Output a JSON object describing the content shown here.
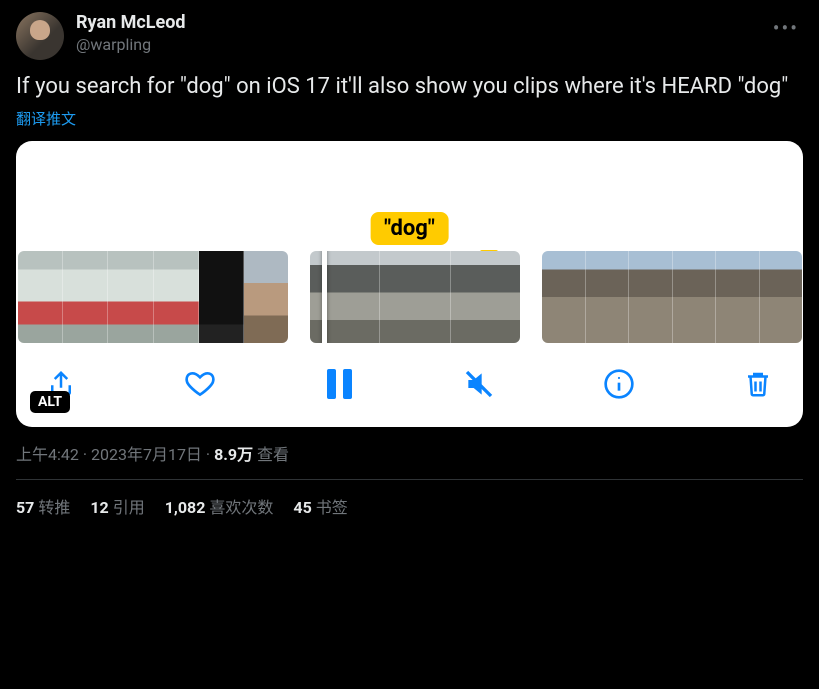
{
  "author": {
    "display_name": "Ryan McLeod",
    "handle": "@warpling"
  },
  "tweet_text": "If you search for \"dog\" on iOS 17 it'll also show you clips where it's HEARD \"dog\"",
  "translate_label": "翻译推文",
  "media": {
    "tag_label": "\"dog\"",
    "alt_badge": "ALT",
    "toolbar": {
      "share": "share",
      "like": "like",
      "pause": "pause",
      "mute": "muted",
      "info": "info",
      "delete": "delete"
    }
  },
  "meta": {
    "time": "上午4:42",
    "sep": " · ",
    "date": "2023年7月17日",
    "views_count": "8.9万",
    "views_label": " 查看"
  },
  "stats": {
    "retweets": {
      "count": "57",
      "label": "转推"
    },
    "quotes": {
      "count": "12",
      "label": "引用"
    },
    "likes": {
      "count": "1,082",
      "label": "喜欢次数"
    },
    "bookmarks": {
      "count": "45",
      "label": "书签"
    }
  }
}
